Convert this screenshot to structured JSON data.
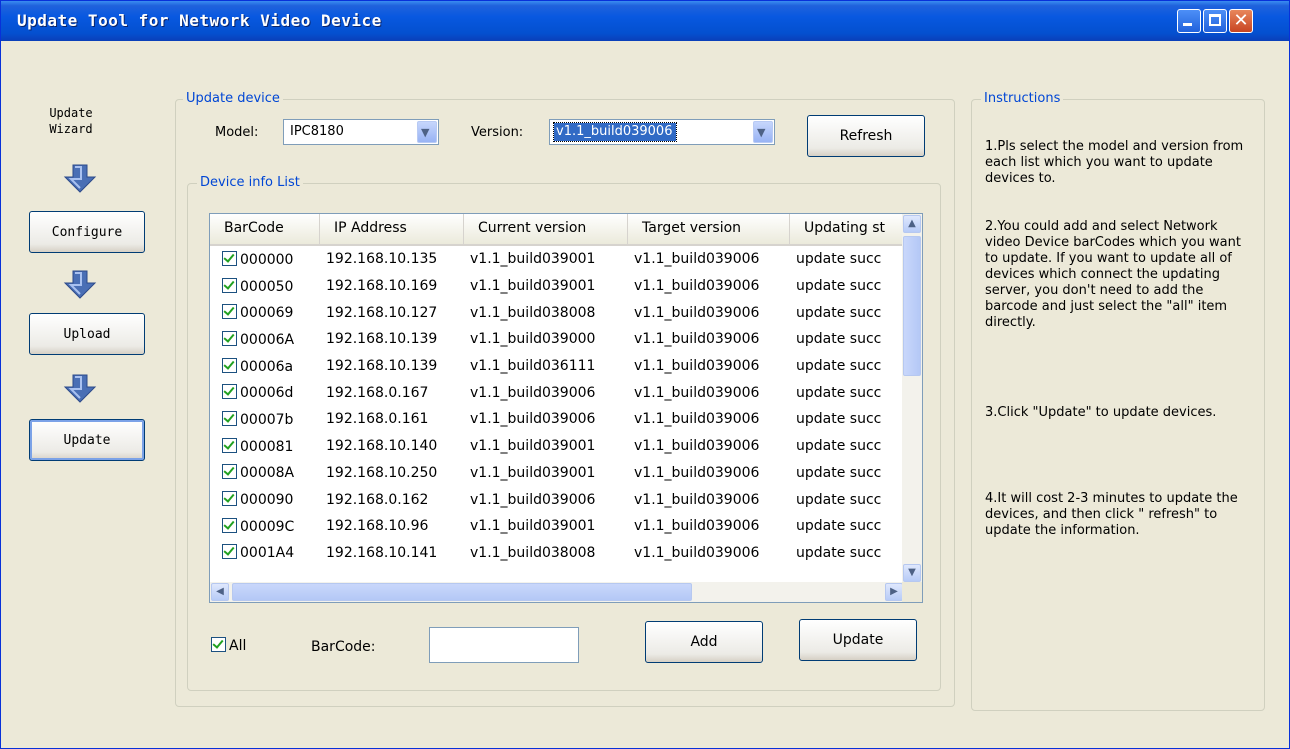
{
  "window": {
    "title": "Update Tool for Network Video Device"
  },
  "wizard": {
    "title": "Update Wizard",
    "configure_label": "Configure",
    "upload_label": "Upload",
    "update_label": "Update"
  },
  "update_device": {
    "group_label": "Update device",
    "model_label": "Model:",
    "model_value": "IPC8180",
    "version_label": "Version:",
    "version_value": "v1.1_build039006",
    "refresh_label": "Refresh"
  },
  "device_list": {
    "group_label": "Device info List",
    "columns": [
      "BarCode",
      "IP Address",
      "Current version",
      "Target version",
      "Updating st"
    ],
    "rows": [
      {
        "barcode": "000000",
        "ip": "192.168.10.135",
        "current": "v1.1_build039001",
        "target": "v1.1_build039006",
        "status": "update succ",
        "checked": true
      },
      {
        "barcode": "000050",
        "ip": "192.168.10.169",
        "current": "v1.1_build039001",
        "target": "v1.1_build039006",
        "status": "update succ",
        "checked": true
      },
      {
        "barcode": "000069",
        "ip": "192.168.10.127",
        "current": "v1.1_build038008",
        "target": "v1.1_build039006",
        "status": "update succ",
        "checked": true
      },
      {
        "barcode": "00006A",
        "ip": "192.168.10.139",
        "current": "v1.1_build039000",
        "target": "v1.1_build039006",
        "status": "update succ",
        "checked": true
      },
      {
        "barcode": "00006a",
        "ip": "192.168.10.139",
        "current": "v1.1_build036111",
        "target": "v1.1_build039006",
        "status": "update succ",
        "checked": true
      },
      {
        "barcode": "00006d",
        "ip": "192.168.0.167",
        "current": "v1.1_build039006",
        "target": "v1.1_build039006",
        "status": "update succ",
        "checked": true
      },
      {
        "barcode": "00007b",
        "ip": "192.168.0.161",
        "current": "v1.1_build039006",
        "target": "v1.1_build039006",
        "status": "update succ",
        "checked": true
      },
      {
        "barcode": "000081",
        "ip": "192.168.10.140",
        "current": "v1.1_build039001",
        "target": "v1.1_build039006",
        "status": "update succ",
        "checked": true
      },
      {
        "barcode": "00008A",
        "ip": "192.168.10.250",
        "current": "v1.1_build039001",
        "target": "v1.1_build039006",
        "status": "update succ",
        "checked": true
      },
      {
        "barcode": "000090",
        "ip": "192.168.0.162",
        "current": "v1.1_build039006",
        "target": "v1.1_build039006",
        "status": "update succ",
        "checked": true
      },
      {
        "barcode": "00009C",
        "ip": "192.168.10.96",
        "current": "v1.1_build039001",
        "target": "v1.1_build039006",
        "status": "update succ",
        "checked": true
      },
      {
        "barcode": "0001A4",
        "ip": "192.168.10.141",
        "current": "v1.1_build038008",
        "target": "v1.1_build039006",
        "status": "update succ",
        "checked": true
      }
    ],
    "all_label": "All",
    "all_checked": true,
    "barcode_label": "BarCode:",
    "barcode_value": "",
    "add_label": "Add",
    "update_label": "Update"
  },
  "instructions": {
    "group_label": "Instructions",
    "steps": [
      "1.Pls select the model and version from each list which you want to update devices to.",
      "2.You could add and select Network video Device barCodes which you want to update. If you want to update all of devices which connect the updating server, you don't need to add the barcode and just select the \"all\" item directly.",
      "3.Click \"Update\" to update devices.",
      "4.It will cost 2-3 minutes to update the devices, and then click \" refresh\" to update the information."
    ]
  },
  "icons": {
    "minimize": "minimize-icon",
    "maximize": "maximize-icon",
    "close": "close-icon",
    "arrow": "arrow-down-icon",
    "combo": "chevron-down-icon"
  },
  "colors": {
    "titlebar": "#0858e0",
    "group_label": "#0046d5",
    "dialog_bg": "#ece9d8",
    "selection": "#316ac5",
    "check": "#21a121"
  }
}
